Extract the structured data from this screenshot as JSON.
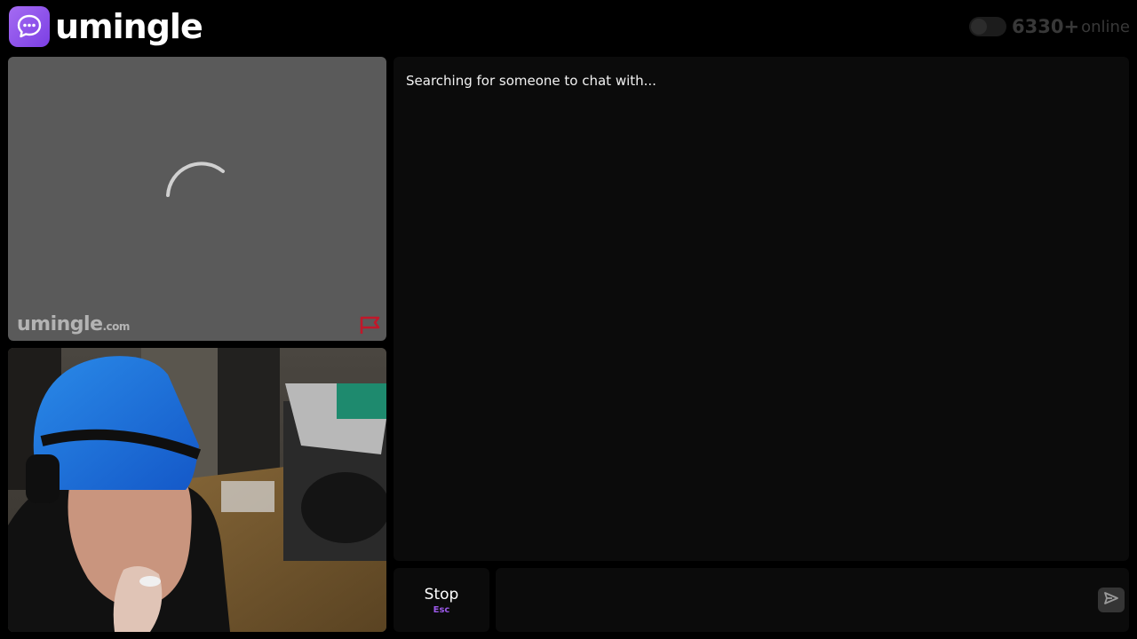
{
  "header": {
    "brand": "umingle",
    "online_count": "6330+",
    "online_label": "online"
  },
  "stranger_video": {
    "watermark_brand": "umingle",
    "watermark_suffix": ".com"
  },
  "chat": {
    "status_text": "Searching for someone to chat with..."
  },
  "controls": {
    "stop_label": "Stop",
    "stop_shortcut": "Esc",
    "message_value": ""
  },
  "colors": {
    "brand": "#8a4de8",
    "report": "#c0182a",
    "background": "#000000",
    "panel": "#0b0b0b"
  }
}
